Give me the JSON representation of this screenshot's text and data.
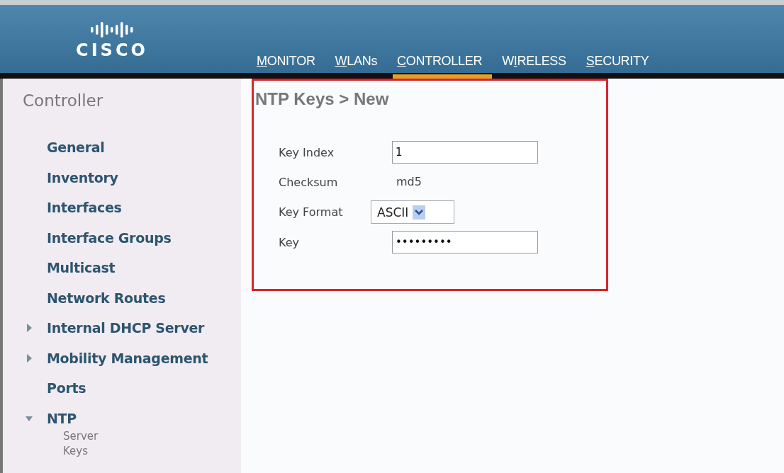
{
  "header": {
    "logo_text": "CISCO",
    "nav": [
      {
        "key": "M",
        "after": "ONITOR",
        "selected": false
      },
      {
        "key": "W",
        "after": "LANs",
        "selected": false
      },
      {
        "key": "C",
        "after": "ONTROLLER",
        "selected": true
      },
      {
        "before": "W",
        "key": "I",
        "after": "RELESS",
        "selected": false
      },
      {
        "key": "S",
        "after": "ECURITY",
        "selected": false
      }
    ]
  },
  "sidebar": {
    "title": "Controller",
    "items": [
      {
        "label": "General"
      },
      {
        "label": "Inventory"
      },
      {
        "label": "Interfaces"
      },
      {
        "label": "Interface Groups"
      },
      {
        "label": "Multicast"
      },
      {
        "label": "Network Routes"
      },
      {
        "label": "Internal DHCP Server",
        "expanded": false
      },
      {
        "label": "Mobility Management",
        "expanded": false
      },
      {
        "label": "Ports"
      },
      {
        "label": "NTP",
        "expanded": true,
        "children": [
          {
            "label": "Server"
          },
          {
            "label": "Keys"
          }
        ]
      }
    ]
  },
  "form": {
    "title": "NTP Keys > New",
    "fields": [
      {
        "kind": "text",
        "label": "Key Index",
        "value": "1"
      },
      {
        "kind": "static",
        "label": "Checksum",
        "value": "md5"
      },
      {
        "kind": "select",
        "label": "Key Format",
        "value": "ASCII"
      },
      {
        "kind": "text",
        "label": "Key",
        "value": "•••••••••"
      }
    ]
  }
}
